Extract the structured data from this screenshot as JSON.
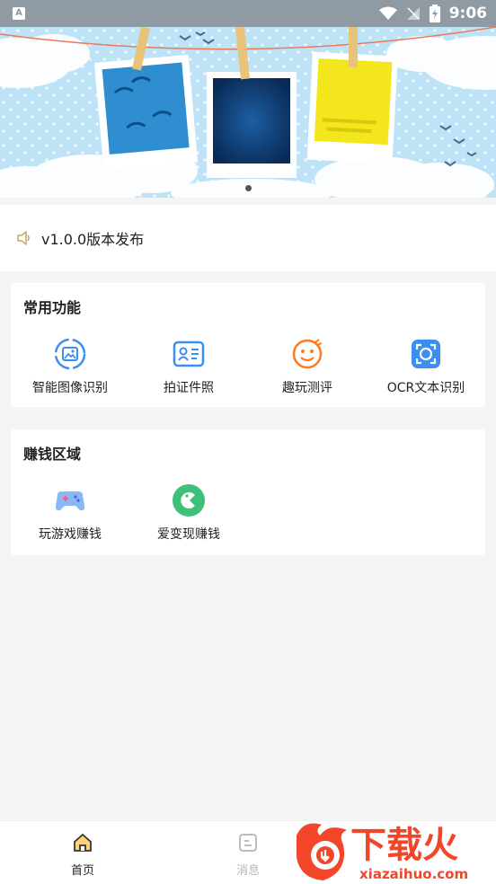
{
  "status_bar": {
    "time": "9:06",
    "app_badge": "A"
  },
  "banner": {
    "slide_count": 3,
    "active_index": 0
  },
  "notice": {
    "icon": "speaker-icon",
    "text": "v1.0.0版本发布"
  },
  "common_section": {
    "title": "常用功能",
    "items": [
      {
        "label": "智能图像识别",
        "icon": "image-recognition-icon",
        "color": "#3b8ff0"
      },
      {
        "label": "拍证件照",
        "icon": "id-card-icon",
        "color": "#3b8ff0"
      },
      {
        "label": "趣玩测评",
        "icon": "fun-test-icon",
        "color": "#ff7a1a"
      },
      {
        "label": "OCR文本识别",
        "icon": "ocr-scan-icon",
        "color": "#3b8ff0"
      }
    ]
  },
  "earn_section": {
    "title": "赚钱区域",
    "items": [
      {
        "label": "玩游戏赚钱",
        "icon": "gamepad-icon",
        "color": "#7b6cf6"
      },
      {
        "label": "爱变现赚钱",
        "icon": "cash-app-icon",
        "color": "#3cc07a"
      }
    ]
  },
  "bottom_nav": {
    "items": [
      {
        "label": "首页",
        "icon": "home-icon",
        "active": true
      },
      {
        "label": "消息",
        "icon": "message-icon",
        "active": false
      }
    ]
  },
  "watermark": {
    "brand": "下载火",
    "url": "xiazaihuo.com"
  }
}
